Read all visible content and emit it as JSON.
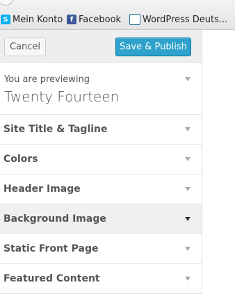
{
  "bookmarks": [
    {
      "label": "Mein Konto",
      "icon": "skype-icon"
    },
    {
      "label": "Facebook",
      "icon": "facebook-icon"
    },
    {
      "label": "WordPress Deuts...",
      "icon": "wordpress-icon"
    }
  ],
  "actions": {
    "cancel_label": "Cancel",
    "publish_label": "Save & Publish",
    "publish_color": "#2ea2cc"
  },
  "theme_info": {
    "previewing_label": "You are previewing",
    "theme_name": "Twenty Fourteen"
  },
  "sections": [
    {
      "title": "Site Title & Tagline"
    },
    {
      "title": "Colors"
    },
    {
      "title": "Header Image"
    },
    {
      "title": "Background Image"
    },
    {
      "title": "Static Front Page"
    },
    {
      "title": "Featured Content"
    }
  ],
  "colors": {
    "panel_bg": "#eeeeee",
    "section_text": "#555555"
  }
}
